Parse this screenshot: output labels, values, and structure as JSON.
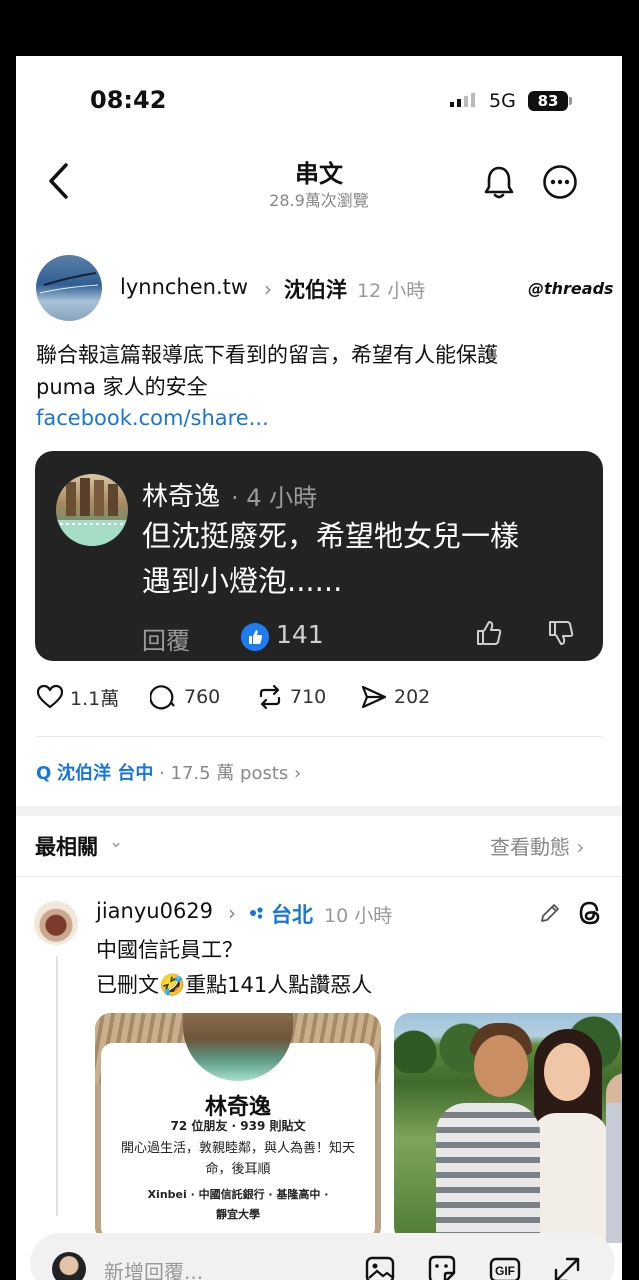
{
  "status_bar": {
    "time": "08:42",
    "network": "5G",
    "battery": "83"
  },
  "header": {
    "title": "串文",
    "views": "28.9萬次瀏覽"
  },
  "post": {
    "username": "lynnchen.tw",
    "location": "沈伯洋",
    "time": "12 小時",
    "badge": "threads",
    "text_line1": "聯合報這篇報導底下看到的留言，希望有人能保護",
    "text_line2": "puma 家人的安全",
    "link": "facebook.com/share..."
  },
  "quoted_comment": {
    "name": "林奇逸",
    "time": "· 4 小時",
    "text_line1": "但沈挺廢死，希望牠女兒一樣",
    "text_line2": "遇到小燈泡......",
    "reply_label": "回覆",
    "like_count": "141"
  },
  "actions": {
    "likes": "1.1萬",
    "comments": "760",
    "reposts": "710",
    "shares": "202"
  },
  "topic": {
    "query": "沈伯洋 台中",
    "count": "· 17.5 萬 posts ›"
  },
  "sort": {
    "label": "最相關",
    "view_activity": "查看動態"
  },
  "reply": {
    "username": "jianyu0629",
    "location": "台北",
    "time": "10 小時",
    "line1": "中國信託員工？",
    "line2": "已刪文🤣重點141人點讚惡人"
  },
  "profile_card": {
    "name": "林奇逸",
    "stats": "72 位朋友 · 939 則貼文",
    "bio_line1": "開心過生活，敦親睦鄰，與人為善！知天",
    "bio_line2": "命，後耳順",
    "meta_line1": "Xinbei · 中國信託銀行 · 基隆高中 ·",
    "meta_line2": "靜宜大學"
  },
  "composer": {
    "placeholder": "新增回覆..."
  },
  "colors": {
    "link": "#1877d6",
    "card_bg": "#232324",
    "like_blue": "#1e7cf2"
  }
}
